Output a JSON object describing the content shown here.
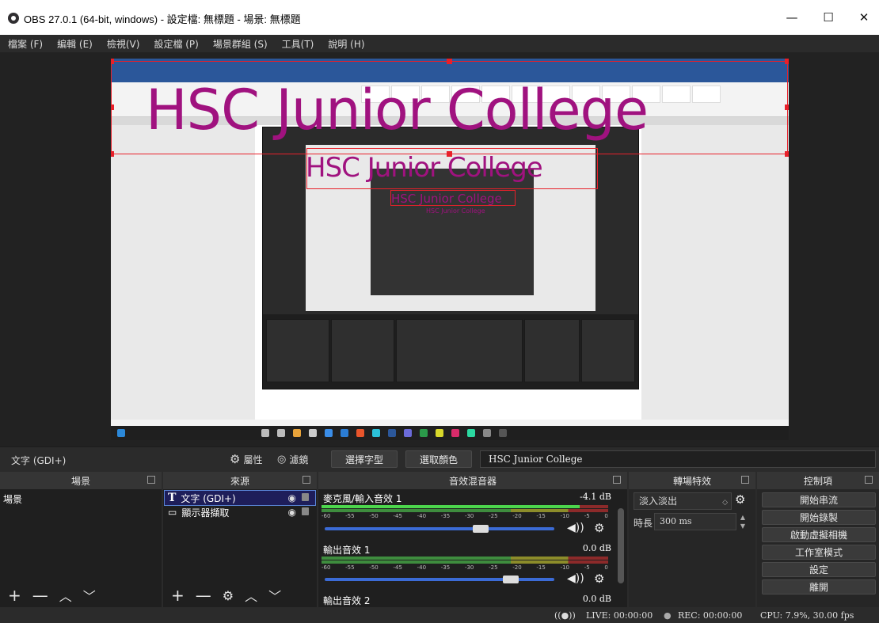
{
  "window": {
    "title": "OBS 27.0.1 (64-bit, windows) - 設定檔: 無標題 - 場景: 無標題",
    "minimize_icon": "—",
    "maximize_icon": "☐",
    "close_icon": "✕"
  },
  "menu": [
    "檔案 (F)",
    "編輯 (E)",
    "檢視(V)",
    "設定檔 (P)",
    "場景群組 (S)",
    "工具(T)",
    "說明 (H)"
  ],
  "preview": {
    "text_large": "HSC Junior College",
    "text_mid": "HSC Junior College",
    "text_small": "HSC Junior College",
    "text_tiny": "HSC Junior College"
  },
  "source_toolbar": {
    "source_name": "文字 (GDI+)",
    "properties_label": "屬性",
    "filters_label": "濾鏡",
    "select_font_label": "選擇字型",
    "select_color_label": "選取顏色",
    "text_value": "HSC Junior College"
  },
  "docks": {
    "scenes": {
      "title": "場景",
      "items": [
        "場景"
      ]
    },
    "sources": {
      "title": "來源",
      "items": [
        "文字 (GDI+)",
        "顯示器擷取"
      ]
    },
    "mixer": {
      "title": "音效混音器",
      "ticks": [
        "-60",
        "-55",
        "-50",
        "-45",
        "-40",
        "-35",
        "-30",
        "-25",
        "-20",
        "-15",
        "-10",
        "-5",
        "0"
      ],
      "channels": [
        {
          "name": "麥克風/輸入音效 1",
          "db": "-4.1 dB",
          "level": 0.9,
          "volume": 0.68
        },
        {
          "name": "輸出音效 1",
          "db": "0.0 dB",
          "level": 0.0,
          "volume": 0.81
        },
        {
          "name": "輸出音效 2",
          "db": "0.0 dB"
        }
      ]
    },
    "transitions": {
      "title": "轉場特效",
      "selected": "淡入淡出",
      "duration_label": "時長",
      "duration_value": "300 ms"
    },
    "controls": {
      "title": "控制項",
      "buttons": [
        "開始串流",
        "開始錄製",
        "啟動虛擬相機",
        "工作室模式",
        "設定",
        "離開"
      ]
    }
  },
  "status": {
    "live": "LIVE: 00:00:00",
    "rec": "REC: 00:00:00",
    "cpu": "CPU: 7.9%, 30.00 fps"
  },
  "colors": {
    "text_magenta": "#a0127f",
    "selection_red": "#e8202a",
    "accent_blue": "#3b6bd6"
  }
}
